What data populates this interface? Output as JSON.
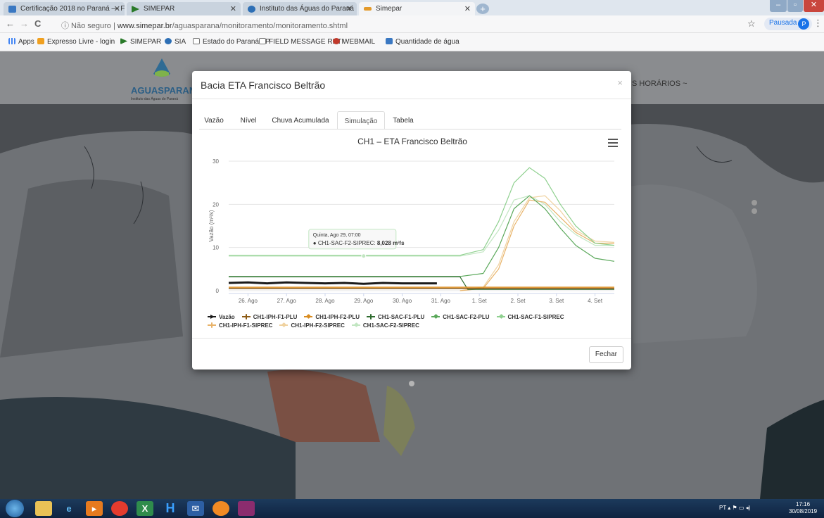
{
  "browser": {
    "tabs": [
      {
        "title": "Certificação 2018 no Paraná — F",
        "active": false
      },
      {
        "title": "SIMEPAR",
        "active": false
      },
      {
        "title": "Instituto das Águas do Paraná",
        "active": false
      },
      {
        "title": "Simepar",
        "active": true
      }
    ],
    "nav": {
      "back": "←",
      "forward": "→",
      "reload": "C"
    },
    "address": {
      "security": "ⓘ Não seguro",
      "separator": "|",
      "host": "www.simepar.br",
      "path": "/aguasparana/monitoramento/monitoramento.shtml"
    },
    "star": "☆",
    "profile": {
      "label": "Pausada",
      "initial": "P"
    },
    "menu": "⋮",
    "bookmarks": [
      "Apps",
      "Expresso Livre - login",
      "SIMEPAR",
      "SIA",
      "Estado do Paraná - P",
      "FIELD MESSAGE RETI",
      "WEBMAIL",
      "Quantidade de água"
    ]
  },
  "site": {
    "logo_text": "AGUASPARANÁ",
    "logo_subtitle": "Instituto das Águas do Paraná",
    "menu_partial": "S HORÁRIOS ~"
  },
  "modal": {
    "title": "Bacia ETA Francisco Beltrão",
    "close": "×",
    "tabs": [
      "Vazão",
      "Nível",
      "Chuva Acumulada",
      "Simulação",
      "Tabela"
    ],
    "active_tab": "Simulação",
    "footer_button": "Fechar"
  },
  "tooltip": {
    "date": "Quinta, Ago 29, 07:00",
    "series": "CH1-SAC-F2-SIPREC:",
    "value": "8,028 m³/s"
  },
  "chart_data": {
    "type": "line",
    "title": "CH1 – ETA Francisco Beltrão",
    "ylabel": "Vazão (m³/s)",
    "ylim": [
      0,
      30
    ],
    "yticks": [
      0,
      10,
      20,
      30
    ],
    "xlim": [
      0,
      10
    ],
    "xticks": [
      {
        "x": 0.5,
        "label": "26. Ago"
      },
      {
        "x": 1.5,
        "label": "27. Ago"
      },
      {
        "x": 2.5,
        "label": "28. Ago"
      },
      {
        "x": 3.5,
        "label": "29. Ago"
      },
      {
        "x": 4.5,
        "label": "30. Ago"
      },
      {
        "x": 5.5,
        "label": "31. Ago"
      },
      {
        "x": 6.5,
        "label": "1. Set"
      },
      {
        "x": 7.5,
        "label": "2. Set"
      },
      {
        "x": 8.5,
        "label": "3. Set"
      },
      {
        "x": 9.5,
        "label": "4. Set"
      }
    ],
    "series": [
      {
        "name": "Vazão",
        "color": "#1a1a1a",
        "width": 3,
        "marker": "arrow",
        "x": [
          0,
          0.5,
          1,
          1.5,
          2,
          2.5,
          3,
          3.5,
          4,
          4.5,
          5,
          5.4
        ],
        "y": [
          1.8,
          1.9,
          1.7,
          1.9,
          1.8,
          1.7,
          1.8,
          1.6,
          1.8,
          1.7,
          1.7,
          1.7
        ]
      },
      {
        "name": "CH1-IPH-F1-PLU",
        "color": "#8c5a14",
        "width": 1.5,
        "marker": "plus",
        "x": [
          0,
          10
        ],
        "y": [
          0.5,
          0.5
        ]
      },
      {
        "name": "CH1-IPH-F2-PLU",
        "color": "#d98c20",
        "width": 1.5,
        "marker": "diamond",
        "x": [
          0,
          10
        ],
        "y": [
          0.8,
          0.8
        ]
      },
      {
        "name": "CH1-SAC-F1-PLU",
        "color": "#2e6b2e",
        "width": 1.2,
        "marker": "plus",
        "x": [
          0,
          6,
          6.2,
          10
        ],
        "y": [
          3.2,
          3.2,
          0.3,
          0.3
        ]
      },
      {
        "name": "CH1-SAC-F2-PLU",
        "color": "#5aa85a",
        "width": 1.2,
        "marker": "diamond",
        "x": [
          0,
          6,
          6.6,
          7,
          7.4,
          7.8,
          8.2,
          8.6,
          9,
          9.5,
          10
        ],
        "y": [
          3.3,
          3.3,
          4,
          10,
          19,
          22,
          19,
          14.5,
          10.5,
          7.5,
          6.8
        ]
      },
      {
        "name": "CH1-SAC-F1-SIPREC",
        "color": "#8fd08f",
        "width": 1.2,
        "marker": "diamond",
        "x": [
          0,
          6,
          6.6,
          7,
          7.4,
          7.8,
          8.2,
          8.6,
          9,
          9.5,
          10
        ],
        "y": [
          8.2,
          8.2,
          9.5,
          16,
          25,
          28.5,
          26,
          20,
          15,
          11,
          10.5
        ]
      },
      {
        "name": "CH1-IPH-F1-SIPREC",
        "color": "#e8b36a",
        "width": 1.2,
        "marker": "plus",
        "x": [
          6,
          6.6,
          7,
          7.4,
          7.8,
          8.2,
          8.6,
          9,
          9.5,
          10
        ],
        "y": [
          0,
          0.5,
          5,
          15,
          21,
          20.5,
          17,
          13.5,
          11,
          11
        ]
      },
      {
        "name": "CH1-IPH-F2-SIPREC",
        "color": "#f0d2a0",
        "width": 1.2,
        "marker": "diamond",
        "x": [
          6,
          6.6,
          7,
          7.4,
          7.8,
          8.2,
          8.6,
          9,
          9.5,
          10
        ],
        "y": [
          0,
          0.8,
          6,
          16,
          21.5,
          22,
          18.5,
          14,
          11.5,
          11.2
        ]
      },
      {
        "name": "CH1-SAC-F2-SIPREC",
        "color": "#c2e6c2",
        "width": 1.2,
        "marker": "diamond",
        "x": [
          0,
          6,
          6.6,
          7,
          7.4,
          7.8,
          8.2,
          8.6,
          9,
          9.5,
          10
        ],
        "y": [
          8.0,
          8.0,
          9,
          14,
          21,
          22,
          20,
          16,
          13,
          10.5,
          10.5
        ]
      }
    ],
    "tooltip_point": {
      "x": 3.5,
      "y": 8.028
    },
    "grid": true,
    "legend_position": "bottom"
  },
  "taskbar": {
    "apps": [
      "ie",
      "explorer",
      "media",
      "chrome",
      "excel",
      "H",
      "outlook",
      "firefox",
      "winrar"
    ],
    "tray_lang": "PT",
    "time": "17:16",
    "date": "30/08/2019"
  }
}
